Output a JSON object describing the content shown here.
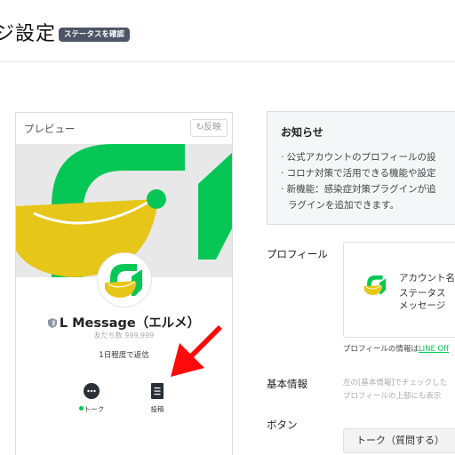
{
  "header": {
    "title": "ジ設定",
    "status_badge": "ステータスを確認"
  },
  "preview": {
    "title": "プレビュー",
    "reflect_button": "↻反映",
    "account_name": "L Message（エルメ）",
    "friends_count": "友だち数 999,999",
    "reply_time": "1日程度で返信",
    "actions": [
      {
        "label": "トーク",
        "icon": "chat-bubble-icon"
      },
      {
        "label": "投稿",
        "icon": "post-icon"
      }
    ]
  },
  "notice": {
    "title": "お知らせ",
    "lines": [
      "· 公式アカウントのプロフィールの設",
      "· コロナ対策で活用できる機能や設定",
      "· 新機能：感染症対策プラグインが追",
      "ラグインを追加できます。"
    ]
  },
  "profile": {
    "label": "プロフィール",
    "card_account_name": "アカウント名",
    "card_status": "ステータス",
    "card_message": "メッセージ",
    "note_prefix": "プロフィールの情報は",
    "note_link": "LINE Off"
  },
  "basic_info": {
    "label": "基本情報",
    "hint_line1": "左の[基本情報]でチェックした",
    "hint_line2": "プロフィールの上部にも表示"
  },
  "button_section": {
    "label": "ボタン",
    "talk_button": "トーク（質問する）"
  },
  "colors": {
    "brand_green": "#06c755",
    "logo_yellow": "#e6c619",
    "annotation_red": "#ff0a0a",
    "badge_bg": "#4d5566"
  }
}
